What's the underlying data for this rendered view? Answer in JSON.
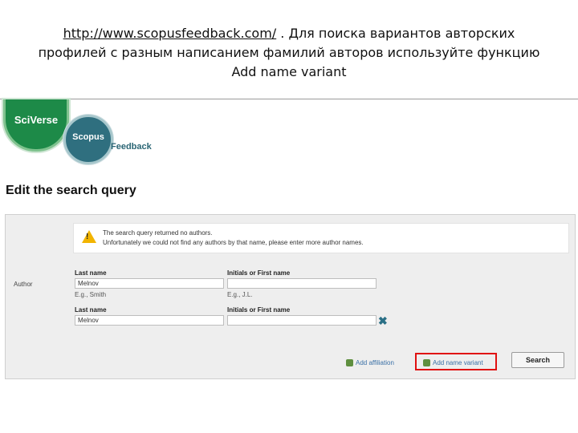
{
  "caption": {
    "url": "http://www.scopusfeedback.com/",
    "line1_rest": " . Для поиска вариантов авторских",
    "line2": "профилей с разным написанием фамилий авторов используйте функцию",
    "line3": "Add name variant"
  },
  "logo": {
    "sciverse": "SciVerse",
    "scopus": "Scopus",
    "feedback": "Feedback"
  },
  "page_title": "Edit the search query",
  "alert": {
    "line1": "The search query returned no authors.",
    "line2": "Unfortunately we could not find any authors by that name, please enter more author names."
  },
  "form": {
    "author_label": "Author",
    "rows": [
      {
        "last_label": "Last name",
        "last_value": "Melnov",
        "last_hint": "E.g., Smith",
        "first_label": "Initials or First name",
        "first_value": "",
        "first_hint": "E.g., J.L."
      },
      {
        "last_label": "Last name",
        "last_value": "Melnov",
        "first_label": "Initials or First name",
        "first_value": ""
      }
    ],
    "add_affiliation": "Add affiliation",
    "add_name_variant": "Add name variant",
    "search": "Search"
  },
  "colors": {
    "highlight": "#e01010",
    "link": "#3a70a6",
    "warning": "#f2b400"
  }
}
